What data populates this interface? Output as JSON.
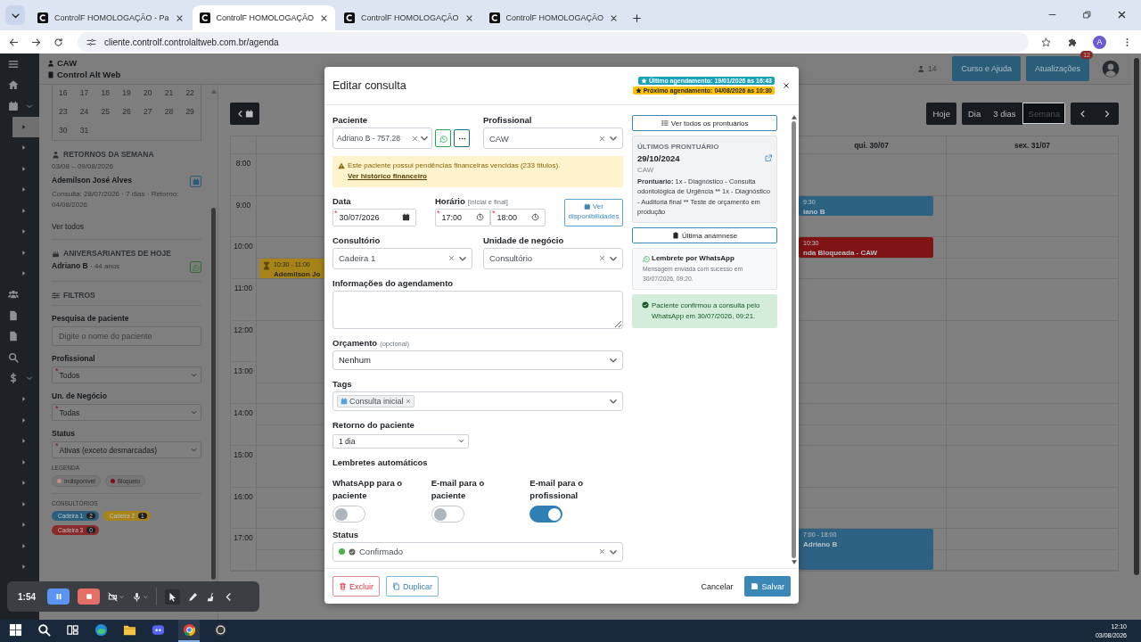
{
  "browser": {
    "tabs": [
      {
        "title": "ControlF HOMOLOGAÇÃO - Pa",
        "selected": false
      },
      {
        "title": "ControlF HOMOLOGAÇÃO",
        "selected": true
      },
      {
        "title": "ControlF HOMOLOGAÇÃO",
        "selected": false
      },
      {
        "title": "ControlF HOMOLOGAÇÃO",
        "selected": false
      }
    ],
    "url": "cliente.controlf.controlaltweb.com.br/agenda",
    "profile": "A"
  },
  "sidebar": {
    "items": [
      {
        "kind": "menu",
        "selected": false
      },
      {
        "kind": "home",
        "selected": false
      },
      {
        "kind": "calendar",
        "selected": false,
        "expanded": true
      },
      {
        "kind": "sub",
        "selected": true
      },
      {
        "kind": "sub",
        "selected": false
      },
      {
        "kind": "sub",
        "selected": false
      },
      {
        "kind": "sub",
        "selected": false
      },
      {
        "kind": "sub",
        "selected": false
      },
      {
        "kind": "sub",
        "selected": false
      },
      {
        "kind": "sub",
        "selected": false
      },
      {
        "kind": "sub",
        "selected": false
      },
      {
        "kind": "users",
        "selected": false
      },
      {
        "kind": "doc",
        "selected": false
      },
      {
        "kind": "doc",
        "selected": false
      },
      {
        "kind": "search",
        "selected": false
      },
      {
        "kind": "dollar",
        "selected": false,
        "expanded": true
      },
      {
        "kind": "sub",
        "selected": false
      },
      {
        "kind": "sub",
        "selected": false
      },
      {
        "kind": "sub",
        "selected": false
      },
      {
        "kind": "sub",
        "selected": false
      },
      {
        "kind": "sub",
        "selected": false
      },
      {
        "kind": "sub",
        "selected": false
      },
      {
        "kind": "sub",
        "selected": false
      },
      {
        "kind": "sub",
        "selected": false
      },
      {
        "kind": "sub",
        "selected": false
      }
    ]
  },
  "header": {
    "user": "CAW",
    "company": "Control Alt Web",
    "counter": "14",
    "buttons": [
      {
        "label": "Curso e Ajuda"
      },
      {
        "label": "Atualizações",
        "badge": "12"
      }
    ]
  },
  "left_panel": {
    "mini_calendar": {
      "weeks": [
        [
          "16",
          "17",
          "18",
          "19",
          "20",
          "21",
          "22"
        ],
        [
          "23",
          "24",
          "25",
          "26",
          "27",
          "28",
          "29"
        ],
        [
          "30",
          "31"
        ]
      ]
    },
    "returns": {
      "title": "RETORNOS DA SEMANA",
      "range": "03/08 – 09/08/2026",
      "items": [
        {
          "name": "Ademilson José Alves",
          "detail": "Consulta: 28/07/2026 · 7 dias · Retorno: 04/08/2026"
        }
      ],
      "link": "Ver todos"
    },
    "birthdays": {
      "title": "ANIVERSARIANTES DE HOJE",
      "items": [
        {
          "name": "Adriano B",
          "age": "· 44 anos"
        }
      ]
    },
    "filters": {
      "title": "FILTROS",
      "fields": [
        {
          "kind": "text",
          "label": "Pesquisa de paciente",
          "placeholder": "Digite o nome do paciente"
        },
        {
          "kind": "select",
          "label": "Profissional",
          "value": "Todos",
          "marker": "*"
        },
        {
          "kind": "select",
          "label": "Un. de Negócio",
          "value": "Todas",
          "marker": "*"
        },
        {
          "kind": "select",
          "label": "Status",
          "value": "Ativas (exceto desmarcadas)",
          "marker": "*"
        }
      ]
    },
    "legend": {
      "title": "LEGENDA",
      "items": [
        {
          "label": "Indisponível",
          "color": "#c98a8a"
        },
        {
          "label": "Bloqueio",
          "color": "#7a1010"
        }
      ]
    },
    "rooms": {
      "title": "CONSULTÓRIOS",
      "items": [
        {
          "label": "Cadeira 1",
          "count": "2",
          "color": "#2c5f7e"
        },
        {
          "label": "Cadeira 2",
          "count": "1",
          "color": "#a7841a"
        },
        {
          "label": "Cadeira 3",
          "count": "0",
          "color": "#8a2a2a"
        }
      ]
    }
  },
  "calendar": {
    "today": "Hoje",
    "views": [
      {
        "label": "Dia",
        "selected": false
      },
      {
        "label": "3 dias",
        "selected": false
      },
      {
        "label": "Semana",
        "selected": true
      }
    ],
    "hours": [
      "8:00",
      "9:00",
      "10:00",
      "11:00",
      "12:00",
      "13:00",
      "14:00",
      "15:00",
      "16:00",
      "17:00"
    ],
    "days": [
      {
        "events": [
          {
            "kind": "pending",
            "color": "#a7841a",
            "time": "10:30 - 11:00",
            "title": "Ademilson Jo"
          }
        ]
      },
      {
        "header": "qui. 30/07",
        "events": [
          {
            "kind": "plain",
            "color": "#2e6283",
            "time": "9:30",
            "title": "iano B"
          },
          {
            "kind": "plain",
            "color": "#801414",
            "time": "10:30",
            "title": "nda Bloqueada - CAW"
          },
          {
            "kind": "plain",
            "color": "#2e6283",
            "time": "7:00 - 18:00",
            "title": "Adriano B"
          }
        ]
      },
      {
        "header": "sex. 31/07"
      }
    ]
  },
  "modal": {
    "title": "Editar consulta",
    "badges": [
      {
        "kind": "last",
        "text": "Último agendamento: 19/01/2026 às 16:43"
      },
      {
        "kind": "next",
        "text": "Próximo agendamento: 04/08/2026 às 10:30"
      }
    ],
    "patient": {
      "label": "Paciente",
      "value": "Adriano B - 757.28"
    },
    "professional": {
      "label": "Profissional",
      "value": "CAW"
    },
    "alert": {
      "text": "Este paciente possui pendências financeiras vencidas (233 títulos).",
      "link": "Ver histórico financeiro"
    },
    "date": {
      "label": "Data",
      "value": "30/07/2026",
      "marker": "*"
    },
    "time": {
      "label": "Horário",
      "hint": "[inicial e final]",
      "start": "17:00",
      "end": "18:00",
      "marker": "*"
    },
    "availability_button": "Ver disponibilidades",
    "room": {
      "label": "Consultório",
      "value": "Cadeira 1"
    },
    "business_unit": {
      "label": "Unidade de negócio",
      "value": "Consultório"
    },
    "notes": {
      "label": "Informações do agendamento"
    },
    "budget": {
      "label": "Orçamento",
      "hint": "(opcional)",
      "value": "Nenhum"
    },
    "tags": {
      "label": "Tags",
      "items": [
        "Consulta inicial"
      ]
    },
    "return": {
      "label": "Retorno do paciente",
      "value": "1 dia"
    },
    "reminders": {
      "title": "Lembretes automáticos",
      "items": [
        {
          "label": "WhatsApp para o paciente",
          "on": false
        },
        {
          "label": "E-mail para o paciente",
          "on": false
        },
        {
          "label": "E-mail para o profissional",
          "on": true
        }
      ]
    },
    "status": {
      "label": "Status",
      "value": "Confirmado",
      "color": "#4caf50"
    },
    "side": {
      "records_button": "Ver todos os prontuários",
      "last_record": {
        "title": "ÚLTIMOS PRONTUÁRIO",
        "date": "29/10/2024",
        "professional": "CAW",
        "text": "**Prontuario:** 1x - Diagnóstico - Consulta odontológica de Urgência ** 1x - Diagnóstico - Auditoria final ** Teste de orçamento em produção"
      },
      "anamnesis_button": "Última anamnese",
      "whatsapp": {
        "title": "Lembrete por WhatsApp",
        "text": "Mensagem enviada com sucesso em 30/07/2026, 09:20."
      },
      "confirmation": "Paciente confirmou a consulta pelo WhatsApp em 30/07/2026, 09:21."
    },
    "footer": {
      "delete": "Excluir",
      "duplicate": "Duplicar",
      "cancel": "Cancelar",
      "save": "Salvar"
    }
  },
  "recorder": {
    "time": "1:54"
  },
  "taskbar": {
    "apps": [
      {
        "kind": "explorer-search",
        "selected": false
      },
      {
        "kind": "taskview",
        "selected": false
      },
      {
        "kind": "edge",
        "selected": false
      },
      {
        "kind": "folder",
        "selected": false
      },
      {
        "kind": "discord",
        "selected": false
      },
      {
        "kind": "chrome",
        "selected": true
      },
      {
        "kind": "obs",
        "selected": false
      }
    ],
    "time": "12:10",
    "date": "03/08/2026"
  }
}
